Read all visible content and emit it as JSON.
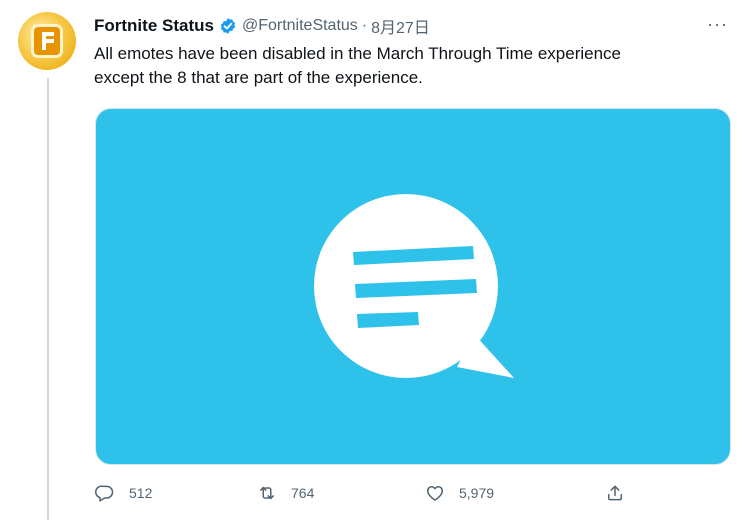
{
  "tweet": {
    "author_name": "Fortnite Status",
    "handle": "@FortniteStatus",
    "separator": "·",
    "date": "8月27日",
    "more_label": "···",
    "text_line1": "All emotes have been disabled in the March Through Time experience",
    "text_line2": "except the 8 that are part of the experience.",
    "media_background": "#2ec1ea",
    "verified_color": "#1d9bf0"
  },
  "actions": {
    "reply_count": "512",
    "retweet_count": "764",
    "like_count": "5,979"
  },
  "icons": [
    "verified-icon",
    "more-icon",
    "reply-icon",
    "retweet-icon",
    "like-icon",
    "share-icon",
    "chat-bubble-icon"
  ]
}
